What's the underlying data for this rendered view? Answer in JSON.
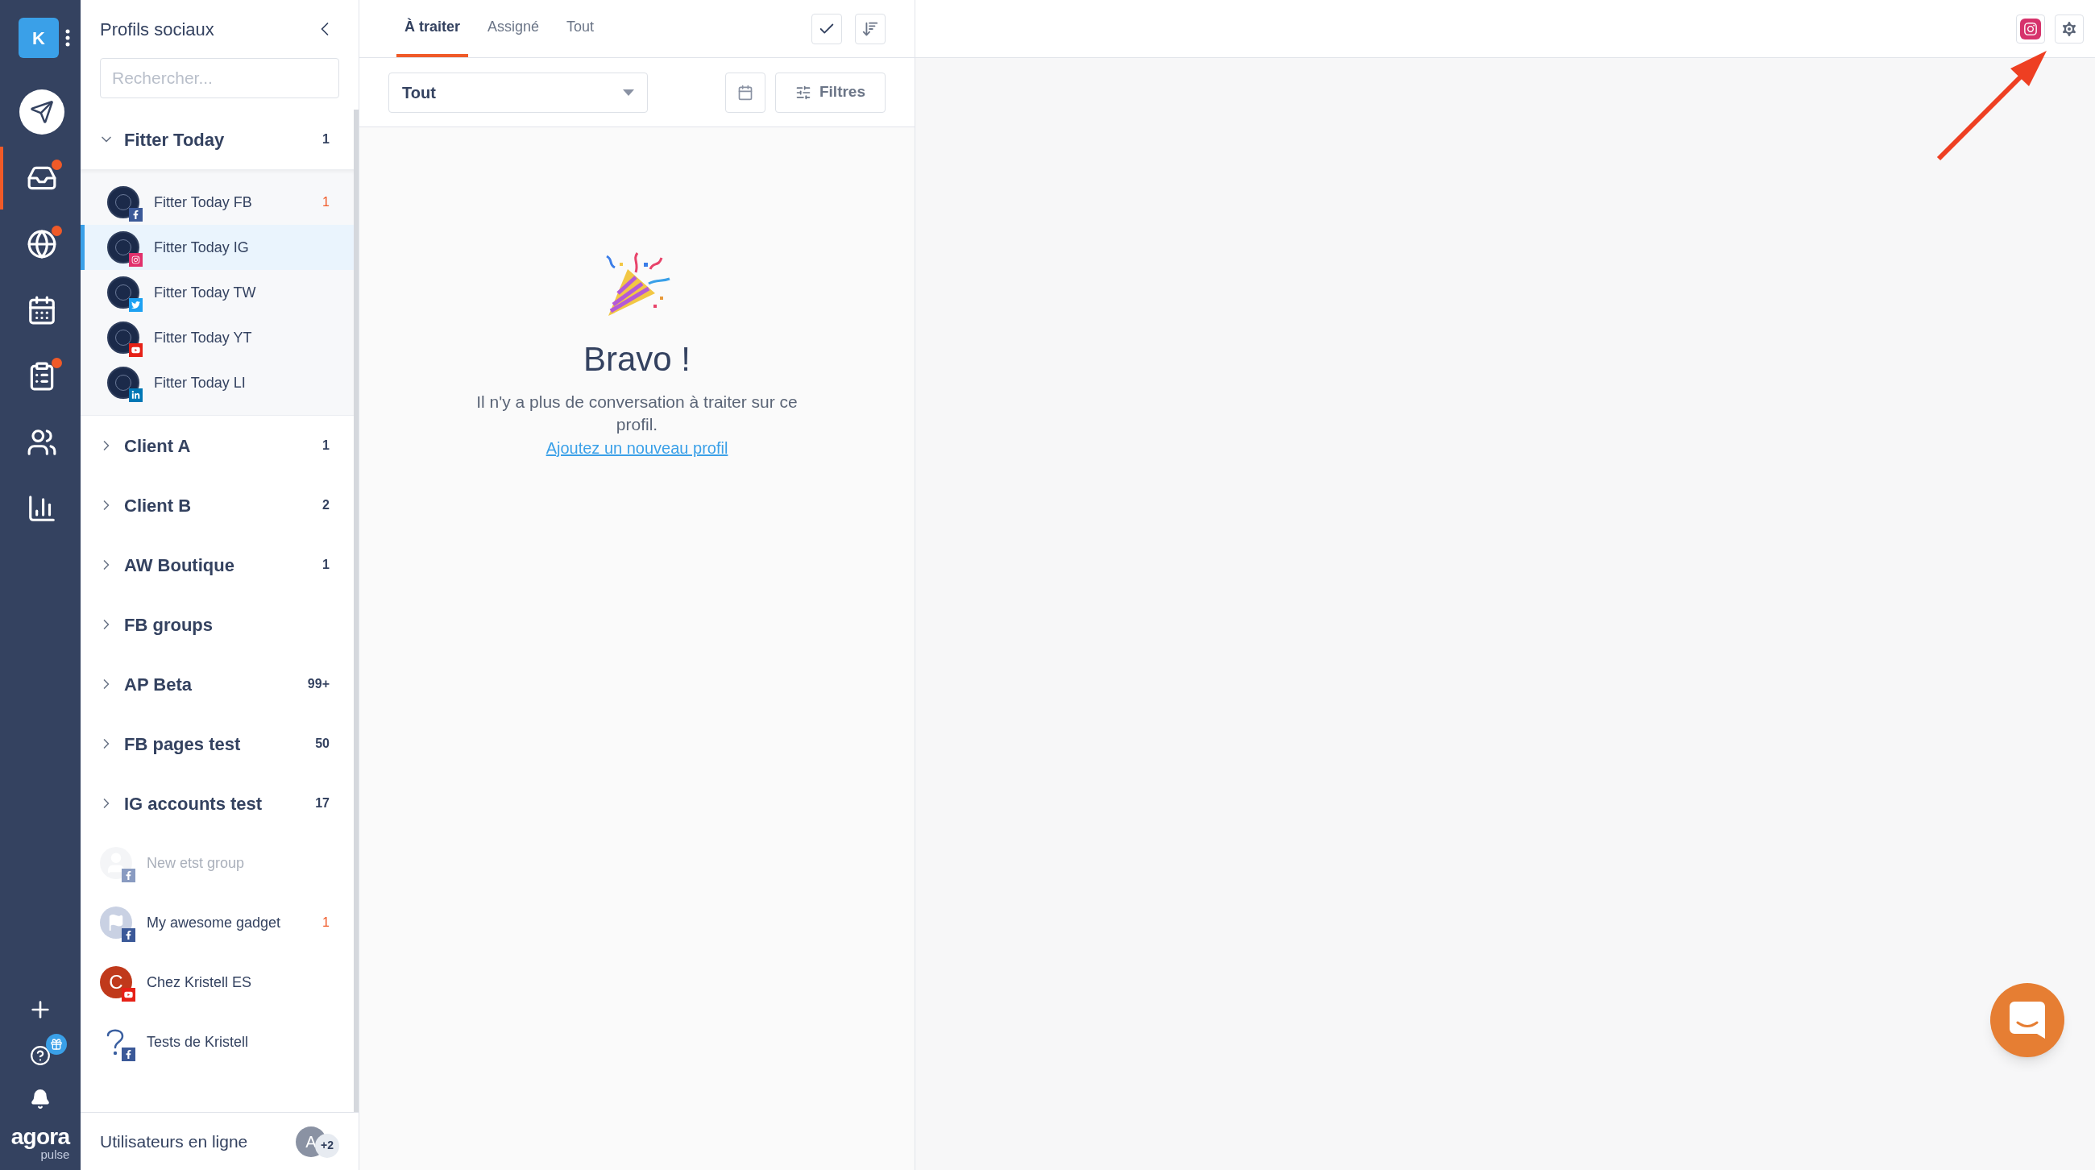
{
  "nav_rail": {
    "account": {
      "initial": "K"
    },
    "items": [
      {
        "kind": "publish",
        "selected": false,
        "badge": false
      },
      {
        "kind": "inbox",
        "selected": true,
        "badge": true
      },
      {
        "kind": "listening",
        "selected": false,
        "badge": true
      },
      {
        "kind": "calendar",
        "selected": false,
        "badge": false
      },
      {
        "kind": "reports",
        "selected": false,
        "badge": true
      },
      {
        "kind": "team",
        "selected": false,
        "badge": false
      },
      {
        "kind": "analytics",
        "selected": false,
        "badge": false
      }
    ],
    "bottom": [
      {
        "kind": "add"
      },
      {
        "kind": "help"
      },
      {
        "kind": "notifications"
      }
    ],
    "logo": {
      "word": "agora",
      "sub": "pulse"
    }
  },
  "sidebar": {
    "title": "Profils sociaux",
    "search": {
      "placeholder": "Rechercher..."
    },
    "groups": [
      {
        "name": "Fitter Today",
        "count": "1",
        "expanded": true,
        "children": [
          {
            "name": "Fitter Today FB",
            "badge": {
              "kind": "facebook"
            },
            "count": "1",
            "selected": false
          },
          {
            "name": "Fitter Today IG",
            "badge": {
              "kind": "instagram"
            },
            "selected": true
          },
          {
            "name": "Fitter Today TW",
            "badge": {
              "kind": "twitter"
            },
            "selected": false
          },
          {
            "name": "Fitter Today YT",
            "badge": {
              "kind": "youtube"
            },
            "selected": false
          },
          {
            "name": "Fitter Today LI",
            "badge": {
              "kind": "linkedin"
            },
            "selected": false
          }
        ]
      },
      {
        "name": "Client A",
        "count": "1",
        "expanded": false
      },
      {
        "name": "Client B",
        "count": "2",
        "expanded": false
      },
      {
        "name": "AW Boutique",
        "count": "1",
        "expanded": false
      },
      {
        "name": "FB groups",
        "expanded": false
      },
      {
        "name": "AP Beta",
        "count": "99+",
        "expanded": false
      },
      {
        "name": "FB pages test",
        "count": "50",
        "expanded": false
      },
      {
        "name": "IG accounts test",
        "count": "17",
        "expanded": false
      }
    ],
    "profiles": [
      {
        "name": "New etst group",
        "avatar": {
          "kind": "person"
        },
        "badge": {
          "kind": "facebook"
        },
        "disabled": true
      },
      {
        "name": "My awesome gadget",
        "avatar": {
          "kind": "flag"
        },
        "badge": {
          "kind": "facebook"
        },
        "count": "1",
        "disabled": false
      },
      {
        "name": "Chez Kristell ES",
        "avatar": {
          "kind": "letter",
          "initial": "C"
        },
        "badge": {
          "kind": "youtube"
        },
        "disabled": false
      },
      {
        "name": "Tests de Kristell",
        "avatar": {
          "kind": "question"
        },
        "badge": {
          "kind": "facebook"
        },
        "disabled": false
      }
    ],
    "footer": {
      "label": "Utilisateurs en ligne",
      "avatar_initial": "A",
      "extra": "+2"
    }
  },
  "inbox": {
    "tabs": [
      {
        "label": "À traiter",
        "selected": true
      },
      {
        "label": "Assigné",
        "selected": false
      },
      {
        "label": "Tout",
        "selected": false
      }
    ],
    "filter_select": {
      "value": "Tout"
    },
    "filters_button": "Filtres",
    "empty_state": {
      "title": "Bravo !",
      "message": "Il n'y a plus de conversation à traiter sur ce profil.",
      "link": "Ajoutez un nouveau profil"
    }
  },
  "detail": {
    "annotation_arrow": true
  }
}
